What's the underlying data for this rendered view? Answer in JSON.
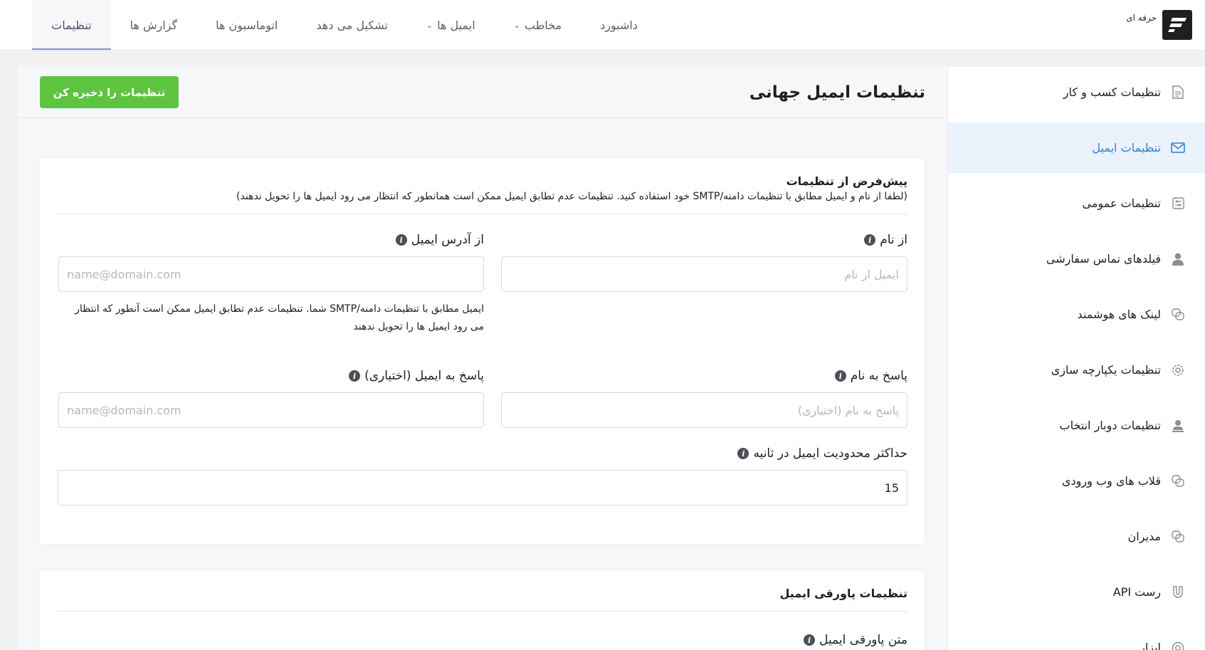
{
  "brand": {
    "label": "حرفه ای"
  },
  "nav": [
    {
      "label": "داشبورد",
      "dropdown": false,
      "active": false
    },
    {
      "label": "مخاطب",
      "dropdown": true,
      "active": false
    },
    {
      "label": "ایمیل ها",
      "dropdown": true,
      "active": false
    },
    {
      "label": "تشکیل می دهد",
      "dropdown": false,
      "active": false
    },
    {
      "label": "اتوماسیون ها",
      "dropdown": false,
      "active": false
    },
    {
      "label": "گزارش ها",
      "dropdown": false,
      "active": false
    },
    {
      "label": "تنظیمات",
      "dropdown": false,
      "active": true
    }
  ],
  "sidebar": {
    "items": [
      {
        "label": "تنظیمات کسب و کار",
        "icon": "document-icon"
      },
      {
        "label": "تنظیمات ایمیل",
        "icon": "envelope-icon"
      },
      {
        "label": "تنظیمات عمومی",
        "icon": "settings-panel-icon"
      },
      {
        "label": "فیلدهای تماس سفارشی",
        "icon": "user-icon"
      },
      {
        "label": "لینک های هوشمند",
        "icon": "link-icon"
      },
      {
        "label": "تنظیمات یکپارچه سازی",
        "icon": "gear-icon"
      },
      {
        "label": "تنظیمات دوبار انتخاب",
        "icon": "user-check-icon"
      },
      {
        "label": "قلاب های وب ورودی",
        "icon": "link-icon"
      },
      {
        "label": "مدیران",
        "icon": "link-icon"
      },
      {
        "label": "رست API",
        "icon": "magnet-icon"
      },
      {
        "label": "ابزار",
        "icon": "lifebuoy-icon"
      }
    ],
    "active_index": 1
  },
  "main": {
    "title": "تنظیمات ایمیل جهانی",
    "save_label": "تنظیمات را ذخیره کن",
    "save_color": "#5ec440"
  },
  "defaults_card": {
    "title": "پیش‌فرض از تنظیمات",
    "subtitle": "(لطفا از نام و ایمیل مطابق با تنظیمات دامنه/SMTP خود استفاده کنید. تنظیمات عدم تطابق ایمیل ممکن است همانطور که انتظار می رود ایمیل ها را تحویل ندهند)",
    "from_name": {
      "label": "از نام",
      "placeholder": "ایمیل از نام",
      "value": ""
    },
    "from_email": {
      "label": "از آدرس ایمیل",
      "placeholder": "name@domain.com",
      "value": ""
    },
    "from_email_help": "ایمیل مطابق با تنظیمات دامنه/SMTP شما. تنظیمات عدم تطابق ایمیل ممکن است آنطور که انتظار می رود ایمیل ها را تحویل ندهند",
    "reply_name": {
      "label": "پاسخ به نام",
      "placeholder": "پاسخ به نام (اختیاری)",
      "value": ""
    },
    "reply_email": {
      "label": "پاسخ به ایمیل (اختیاری)",
      "placeholder": "name@domain.com",
      "value": ""
    },
    "rate_limit": {
      "label": "حداکثر محدودیت ایمیل در ثانیه",
      "value": "15"
    }
  },
  "footer_card": {
    "title": "تنظیمات پاورقی ایمیل",
    "footer_text_label": "متن پاورقی ایمیل"
  }
}
